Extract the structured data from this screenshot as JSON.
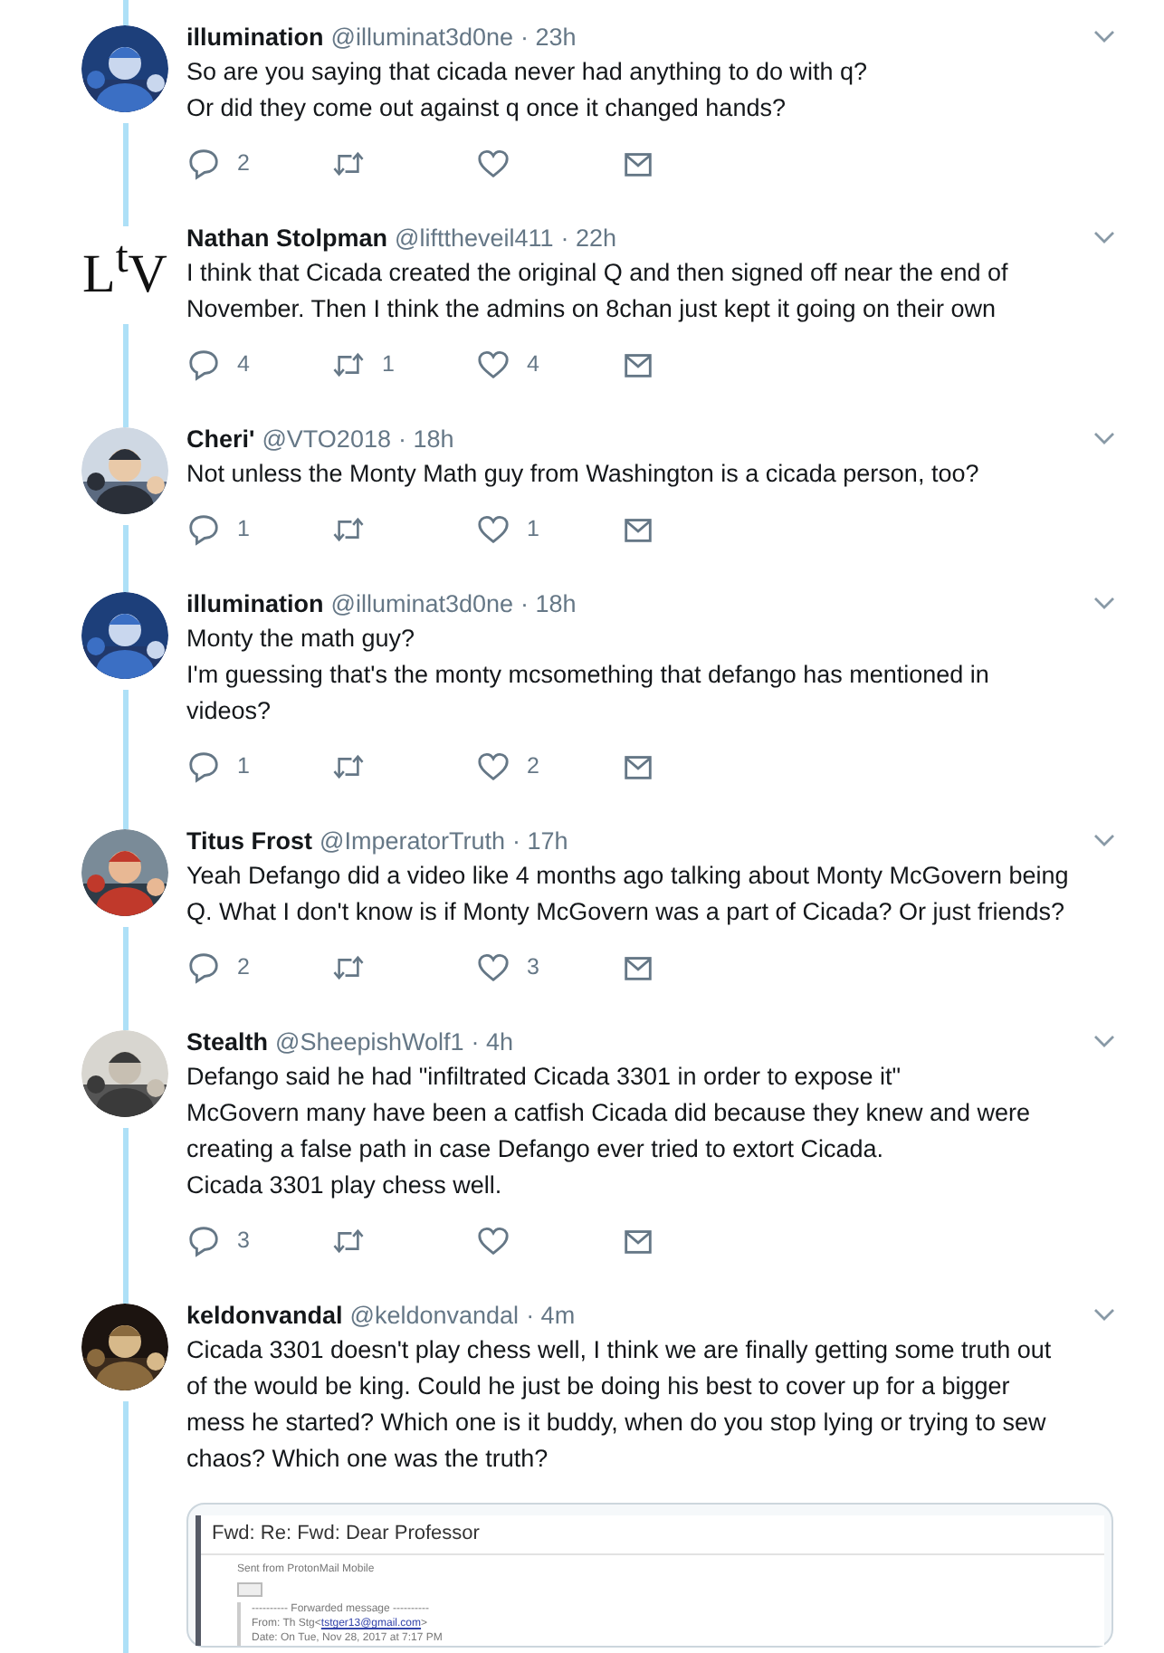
{
  "tweets": [
    {
      "name": "illumination",
      "handle": "@illuminat3d0ne",
      "time": "· 23h",
      "body": "So are you saying that cicada never had anything to do with q?\nOr did they come out against q once it changed hands?",
      "actions": {
        "replies": "2"
      }
    },
    {
      "avatar": {
        "kind": "logo",
        "text": "L$^{t}$V"
      },
      "name": "Nathan Stolpman",
      "handle": "@lifttheveil411",
      "time": "· 22h",
      "body": "I think that Cicada created the original Q and then signed off near the end of November. Then I think the admins on 8chan just kept it going on their own",
      "actions": {
        "replies": "4",
        "retweets": "1",
        "likes": "4"
      }
    },
    {
      "name": "Cheri'",
      "handle": "@VTO2018",
      "time": "· 18h",
      "body": "Not unless the Monty Math guy from Washington is a cicada person, too?",
      "actions": {
        "replies": "1",
        "likes": "1"
      }
    },
    {
      "name": "illumination",
      "handle": "@illuminat3d0ne",
      "time": "· 18h",
      "body": "Monty the math guy?\nI'm guessing that's the monty mcsomething that defango has mentioned in videos?",
      "actions": {
        "replies": "1",
        "likes": "2"
      }
    },
    {
      "name": "Titus Frost",
      "handle": "@ImperatorTruth",
      "time": "· 17h",
      "body": "Yeah Defango did a video like 4 months ago talking about Monty McGovern being Q. What I don't know is if Monty McGovern was a part of Cicada? Or just friends?",
      "actions": {
        "replies": "2",
        "likes": "3"
      }
    },
    {
      "name": "Stealth",
      "handle": "@SheepishWolf1",
      "time": "· 4h",
      "body": "Defango said he had \"infiltrated Cicada 3301 in order to expose it\"\nMcGovern many have been a catfish Cicada did because they knew and were creating a false path in case Defango ever tried to extort Cicada.\nCicada 3301 play chess well.",
      "actions": {
        "replies": "3"
      }
    },
    {
      "name": "keldonvandal",
      "handle": "@keldonvandal",
      "time": "· 4m",
      "body": "Cicada 3301 doesn't play chess well, I think we are finally getting some truth out of the would be king. Could he just be doing his best to cover up for a bigger mess he started? Which one is it buddy, when do you stop lying or trying to sew chaos? Which one was the truth?",
      "attachment": {
        "kind": "email",
        "subject": "Fwd: Re: Fwd: Dear Professor",
        "sent_from": "Sent from ProtonMail Mobile",
        "forwarded": "---------- Forwarded message ----------",
        "from": "From: Th Stg<",
        "from_email": "tstger13@gmail.com",
        "from_end": ">",
        "date": "Date: On Tue, Nov 28, 2017 at 7:17 PM"
      }
    }
  ]
}
